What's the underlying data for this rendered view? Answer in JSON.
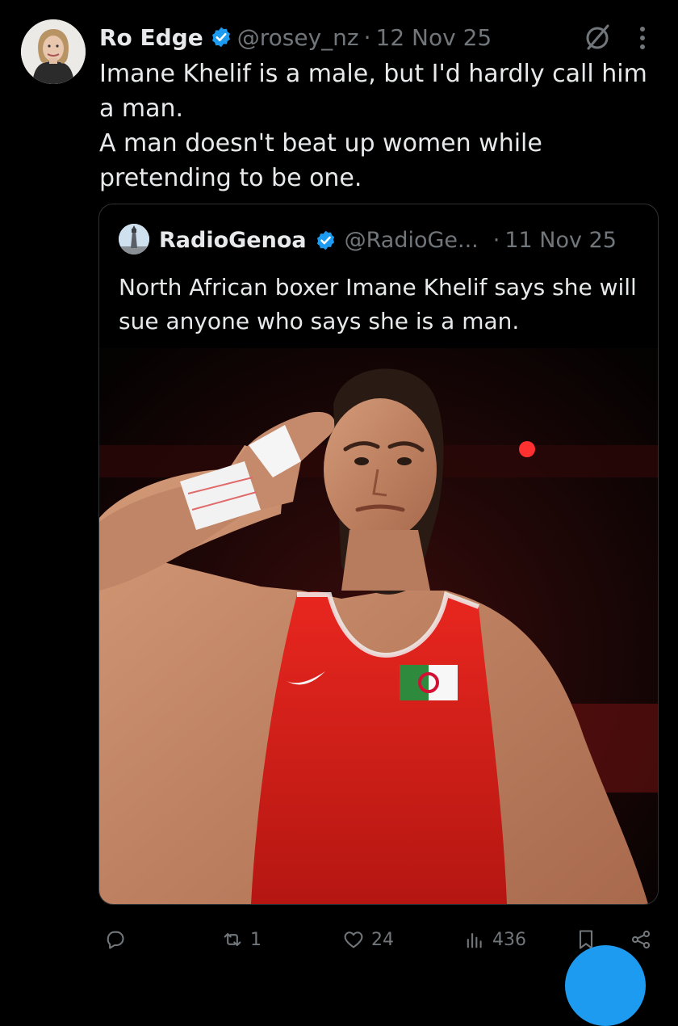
{
  "colors": {
    "background": "#000000",
    "text_primary": "#e7e9ea",
    "text_secondary": "#71767b",
    "accent": "#1d9bf0",
    "border": "#2f3336"
  },
  "tweet": {
    "author": {
      "display_name": "Ro Edge",
      "handle": "@rosey_nz",
      "verified_icon": "verified-badge-icon",
      "avatar_icon": "user-avatar"
    },
    "separator": "·",
    "date": "12 Nov 25",
    "text_lines": [
      "Imane Khelif is a male, but I'd hardly call him a man.",
      "A man doesn't beat up women while pretending to be one."
    ]
  },
  "quoted_tweet": {
    "author": {
      "display_name": "RadioGenoa",
      "handle": "@RadioGe...",
      "verified_icon": "verified-badge-icon",
      "avatar_icon": "lighthouse-avatar"
    },
    "separator": "·",
    "date": "11 Nov 25",
    "text": "North African boxer Imane Khelif says she will sue anyone who says she is a man.",
    "photo": {
      "icon": "boxer-saluting-photo"
    }
  },
  "actions": {
    "reply": {
      "icon": "reply-icon",
      "count": ""
    },
    "retweet": {
      "icon": "retweet-icon",
      "count": "1"
    },
    "like": {
      "icon": "heart-icon",
      "count": "24"
    },
    "views": {
      "icon": "views-icon",
      "count": "436"
    },
    "bookmark": {
      "icon": "bookmark-icon"
    },
    "share": {
      "icon": "share-icon"
    }
  },
  "top_icons": {
    "grok": "grok-icon",
    "more": "more-icon"
  }
}
